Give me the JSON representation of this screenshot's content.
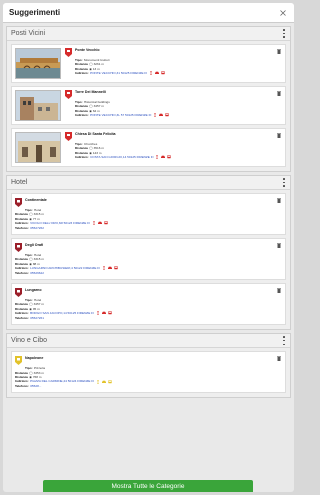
{
  "header": {
    "title": "Suggerimenti"
  },
  "sections": [
    {
      "title": "Posti Vicini",
      "items": [
        {
          "name": "Ponte Vecchio",
          "type_label": "Tipo:",
          "type": "Monumenti Icuttori",
          "dist_label": "Distanza",
          "dist_walk": "3261 m",
          "dist_car": "13 m",
          "addr_label": "Indirizzo:",
          "address": "PONTE VECCHIO,31 50125 FIRENZE FI"
        },
        {
          "name": "Torre Dei Mannelli",
          "type_label": "Tipo:",
          "type": "Historical buildings",
          "dist_label": "Distanza",
          "dist_walk": "3457 m",
          "dist_car": "64 m",
          "addr_label": "Indirizzo:",
          "address": "PONTE VECCHIO,3L 57 50125 FIRENZE FI"
        },
        {
          "name": "Chiesa Di Santa Felicita",
          "type_label": "Tipo:",
          "type": "Churches",
          "dist_label": "Distanza",
          "dist_walk": "3516 m",
          "dist_car": "143 m",
          "addr_label": "Indirizzo:",
          "address": "COSTA SAN GIORGIO,14 50125 FIRENZE FI"
        }
      ]
    },
    {
      "title": "Hotel",
      "items": [
        {
          "name": "Continentale",
          "type_label": "Tipo:",
          "type": "Hotel",
          "dist_label": "Distanza",
          "dist_walk": "3315 m",
          "dist_car": "77 m",
          "addr_label": "Indirizzo:",
          "address": "VICOLO DELL'ORO,6R 50123 FIRENZE FI",
          "phone_label": "Telefono:",
          "phone": "05527262"
        },
        {
          "name": "Degli Orafi",
          "type_label": "Tipo:",
          "type": "Hotel",
          "dist_label": "Distanza",
          "dist_walk": "3315 m",
          "dist_car": "88 m",
          "addr_label": "Indirizzo:",
          "address": "LUNGARNO ARCHIBUSIERI,4 50122 FIRENZE FI",
          "phone_label": "Telefono:",
          "phone": "05526622"
        },
        {
          "name": "Lungarno",
          "type_label": "Tipo:",
          "type": "Hotel",
          "dist_label": "Distanza",
          "dist_walk": "3457 m",
          "dist_car": "95 m",
          "addr_label": "Indirizzo:",
          "address": "BORGO SAN JACOPO,14 50125 FIRENZE FI",
          "phone_label": "Telefono:",
          "phone": "05527261"
        }
      ]
    },
    {
      "title": "Vino e Cibo",
      "items": [
        {
          "name": "Napoleone",
          "type_label": "Tipo:",
          "type": "Pizzeria",
          "dist_label": "Distanza",
          "dist_walk": "3353 m",
          "dist_car": "768 m",
          "addr_label": "Indirizzo:",
          "address": "PIAZZA DEL CARMINE,24 50124 FIRENZE FI",
          "phone_label": "Telefono:",
          "phone": "05528..."
        }
      ]
    }
  ],
  "footer": {
    "button_label": "Mostra Tutte le Categorie"
  },
  "colors": {
    "pin_red": "#d62b2b",
    "pin_yellow": "#e2c22a",
    "link_blue": "#2a4fbf",
    "button_green": "#3aa53a"
  }
}
